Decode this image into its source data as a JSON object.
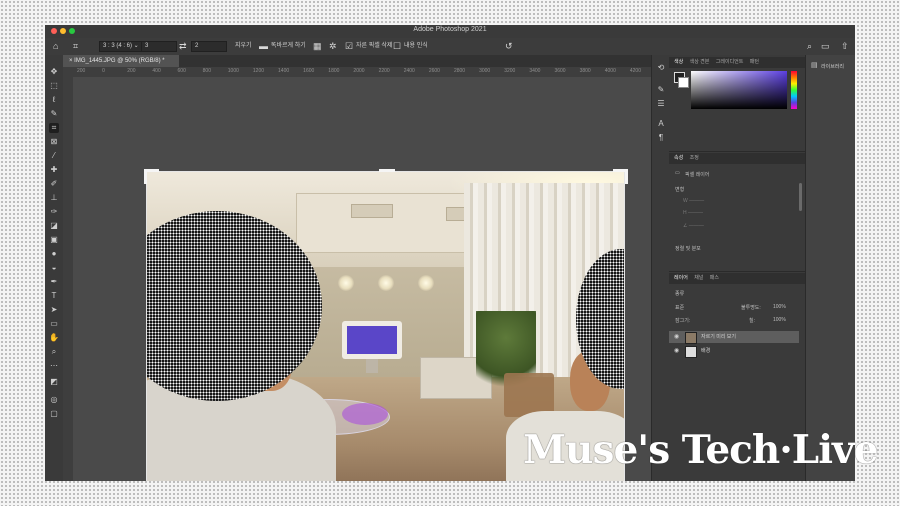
{
  "window": {
    "title": "Adobe Photoshop 2021"
  },
  "options_bar": {
    "ratio_select": "3 : 3 (4 : 6) ⌄",
    "ratio_value": "3",
    "swap_icon": "swap-icon",
    "second_value": "2",
    "clear_label": "지우기",
    "straighten_label": "똑바르게 하기",
    "delete_cropped_label": "자른 픽셀 삭제",
    "content_aware_label": "내용 인식"
  },
  "document": {
    "tab_title": "IMG_1445.JPG @ 50% (RGB/8) *",
    "ruler_ticks": [
      "200",
      "0",
      "200",
      "400",
      "600",
      "800",
      "1000",
      "1200",
      "1400",
      "1600",
      "1800",
      "2000",
      "2200",
      "2400",
      "2600",
      "2800",
      "3000",
      "3200",
      "3400",
      "3600",
      "3800",
      "4000",
      "4200"
    ]
  },
  "panels": {
    "color_tabs": [
      "색상",
      "색상 견본",
      "그레이디언트",
      "패턴"
    ],
    "properties_tabs": [
      "속성",
      "조정"
    ],
    "properties_layer_label": "픽셀 레이어",
    "transform_label": "변형",
    "align_label": "정렬 및 분포",
    "layers_tabs": [
      "레이어",
      "채널",
      "패스"
    ],
    "search_placeholder": "종류",
    "blend_mode": "표준",
    "opacity_label": "불투명도:",
    "opacity_value": "100%",
    "lock_label": "잠그기:",
    "fill_label": "칠:",
    "fill_value": "100%",
    "layers": [
      {
        "name": "자르기 미리 보기",
        "selected": true
      },
      {
        "name": "배경",
        "selected": false
      }
    ]
  },
  "libraries": {
    "label": "라이브러리"
  },
  "watermark": {
    "text": "Muse's Tech·Live"
  },
  "colors": {
    "accent_purple": "#5b3fe0",
    "app_bg": "#535353"
  }
}
